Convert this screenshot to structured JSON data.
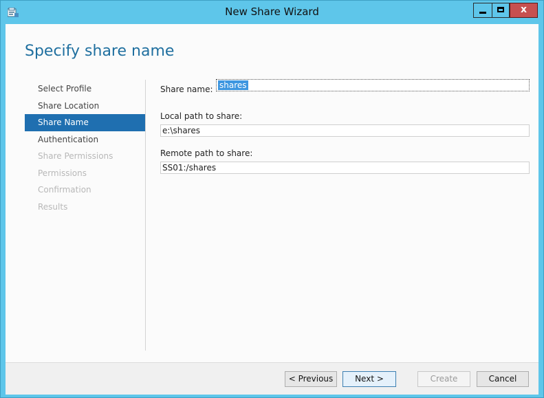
{
  "window": {
    "title": "New Share Wizard",
    "icons": {
      "app": "wizard-app-icon",
      "minimize": "minimize-icon",
      "maximize": "maximize-icon",
      "close": "close-icon"
    },
    "close_glyph": "x"
  },
  "page": {
    "title": "Specify share name"
  },
  "nav": {
    "items": [
      {
        "label": "Select Profile",
        "state": "normal"
      },
      {
        "label": "Share Location",
        "state": "normal"
      },
      {
        "label": "Share Name",
        "state": "selected"
      },
      {
        "label": "Authentication",
        "state": "normal"
      },
      {
        "label": "Share Permissions",
        "state": "disabled"
      },
      {
        "label": "Permissions",
        "state": "disabled"
      },
      {
        "label": "Confirmation",
        "state": "disabled"
      },
      {
        "label": "Results",
        "state": "disabled"
      }
    ]
  },
  "form": {
    "share_name_label": "Share name:",
    "share_name_value": "shares",
    "local_path_label": "Local path to share:",
    "local_path_value": "e:\\shares",
    "remote_path_label": "Remote path to share:",
    "remote_path_value": "SS01:/shares"
  },
  "buttons": {
    "previous": "< Previous",
    "next": "Next >",
    "create": "Create",
    "cancel": "Cancel"
  },
  "colors": {
    "accent": "#1f6fb0",
    "title_bar": "#5ec6ea",
    "close": "#c75050"
  }
}
